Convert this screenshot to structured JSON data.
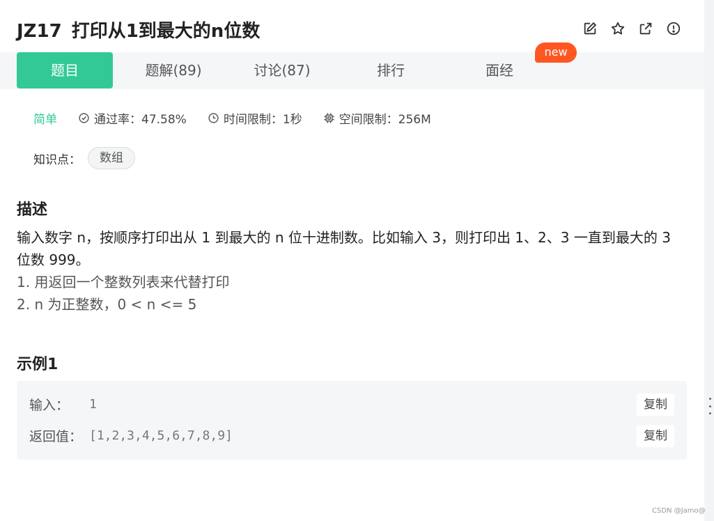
{
  "problem": {
    "code": "JZ17",
    "title": "打印从1到最大的n位数"
  },
  "actions": [
    {
      "icon": "edit-icon"
    },
    {
      "icon": "star-icon"
    },
    {
      "icon": "share-icon"
    },
    {
      "icon": "report-icon"
    }
  ],
  "tabs": [
    {
      "label": "题目",
      "active": true
    },
    {
      "label": "题解(89)"
    },
    {
      "label": "讨论(87)"
    },
    {
      "label": "排行"
    },
    {
      "label": "面经"
    }
  ],
  "badge": "new",
  "meta": {
    "difficulty": "简单",
    "pass_rate": "通过率：47.58%",
    "time_limit": "时间限制：1秒",
    "memory_limit": "空间限制：256M"
  },
  "knowledge": {
    "label": "知识点：",
    "tags": [
      "数组"
    ]
  },
  "description": {
    "heading": "描述",
    "line1": "输入数字 n，按顺序打印出从 1 到最大的 n 位十进制数。比如输入 3，则打印出 1、2、3 一直到最大的 3 位数 999。",
    "note1": "1. 用返回一个整数列表来代替打印",
    "note2": "2. n 为正整数，0 < n <= 5"
  },
  "example": {
    "heading": "示例1",
    "input_label": "输入：",
    "input_value": "1",
    "output_label": "返回值：",
    "output_value": "[1,2,3,4,5,6,7,8,9]",
    "copy_label": "复制"
  },
  "watermark": "CSDN @Jamo@",
  "colors": {
    "accent": "#32c997",
    "badge": "#ff5722"
  }
}
